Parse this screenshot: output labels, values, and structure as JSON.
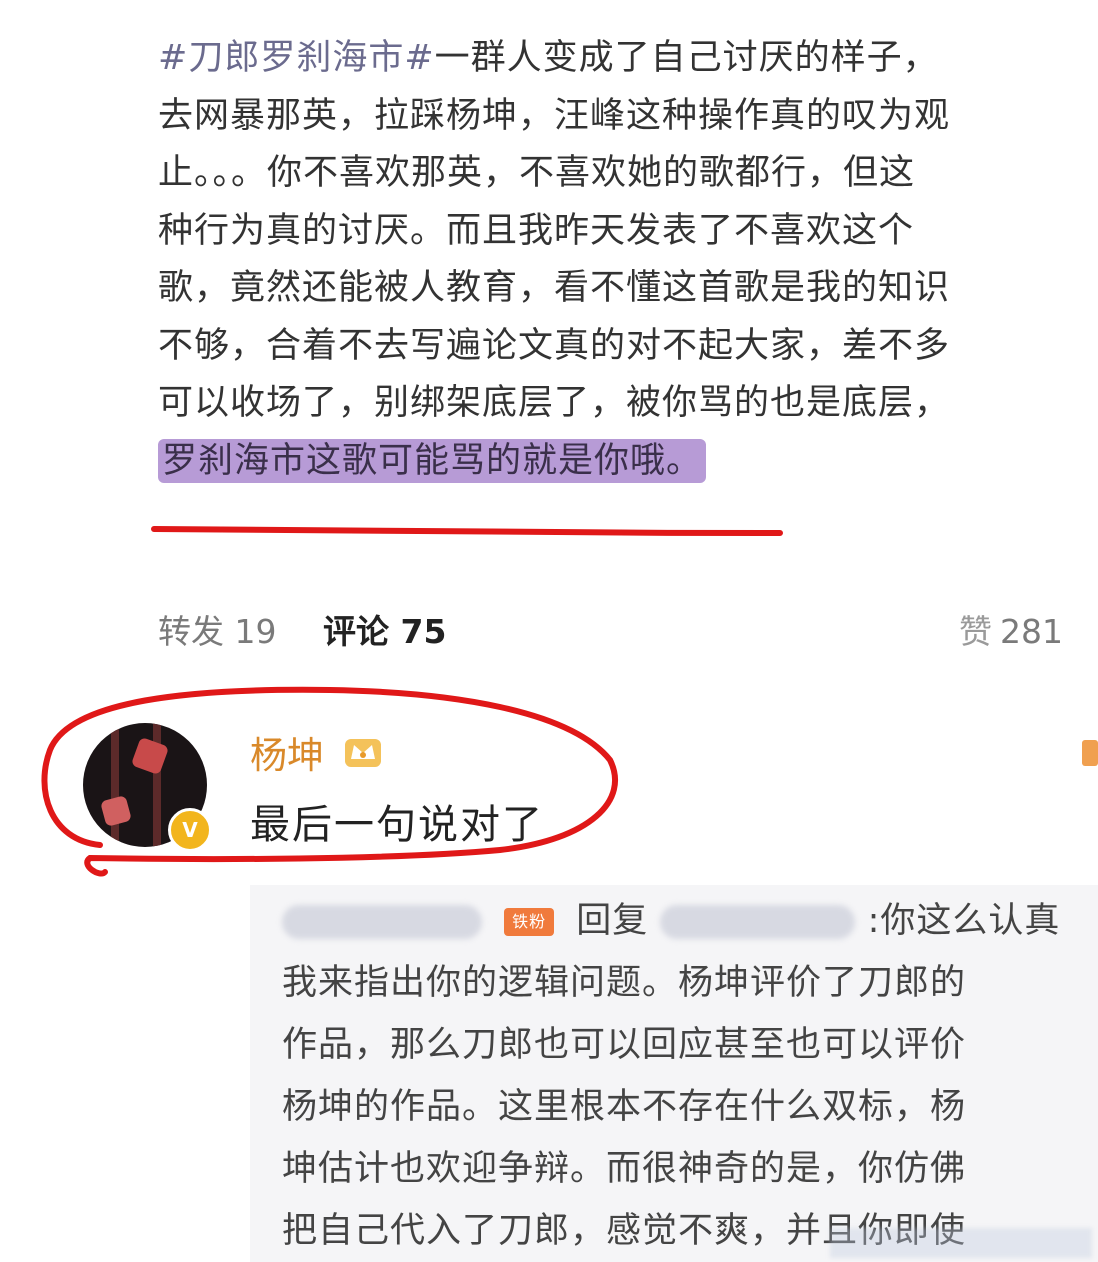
{
  "post": {
    "lines": [
      "#刀郎罗刹海市#一群人变成了自己讨厌的样子，",
      "去网暴那英，拉踩杨坤，汪峰这种操作真的叹为观",
      "止。。。你不喜欢那英，不喜欢她的歌都行，但这",
      "种行为真的讨厌。而且我昨天发表了不喜欢这个",
      "歌，竟然还能被人教育，看不懂这首歌是我的知识",
      "不够，合着不去写遍论文真的对不起大家，差不多",
      "可以收场了，别绑架底层了，被你骂的也是底层，"
    ],
    "highlight": "罗刹海市这歌可能骂的就是你哦。"
  },
  "actions": {
    "repost": "转发 19",
    "comment": "评论 75",
    "like_icon": "赞",
    "like": "281"
  },
  "comment": {
    "username": "杨坤",
    "badge_letter": "V",
    "text": "最后一句说对了"
  },
  "sub_reply": {
    "level_badge": "铁粉",
    "reply_word": "回复",
    "lead": ":你这么认真",
    "lines": [
      "我来指出你的逻辑问题。杨坤评价了刀郎的",
      "作品，那么刀郎也可以回应甚至也可以评价",
      "杨坤的作品。这里根本不存在什么双标，杨",
      "坤估计也欢迎争辩。而很神奇的是，你仿佛",
      "把自己代入了刀郎，感觉不爽，并且你即使"
    ]
  },
  "colors": {
    "highlight": "#b79bd6",
    "username": "#d9892a",
    "annotation_red": "#e01818",
    "sub_bg": "#f5f5f7"
  }
}
